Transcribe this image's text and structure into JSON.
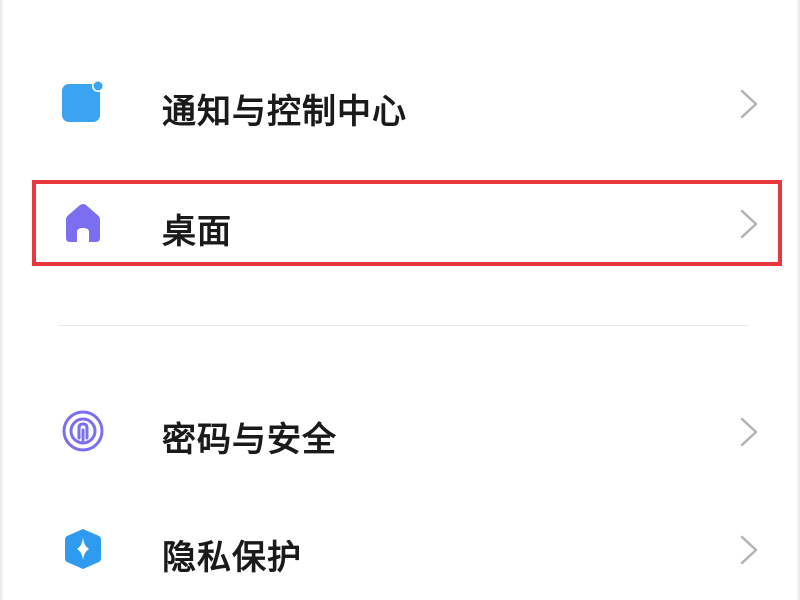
{
  "settings_list": {
    "partial_top_item": {
      "label": "",
      "icon": "green-settings-icon"
    },
    "items": [
      {
        "label": "通知与控制中心",
        "icon": "notification-icon",
        "icon_color": "#3aa3f2"
      },
      {
        "label": "桌面",
        "icon": "home-icon",
        "icon_color": "#7b6ef0"
      },
      {
        "label": "密码与安全",
        "icon": "fingerprint-icon",
        "icon_color": "#7a6ff0"
      },
      {
        "label": "隐私保护",
        "icon": "privacy-shield-icon",
        "icon_color": "#2f9bf0"
      }
    ],
    "highlighted_item": "桌面",
    "highlight_color": "#e8383d",
    "chevron_icon": "chevron-right-icon"
  }
}
